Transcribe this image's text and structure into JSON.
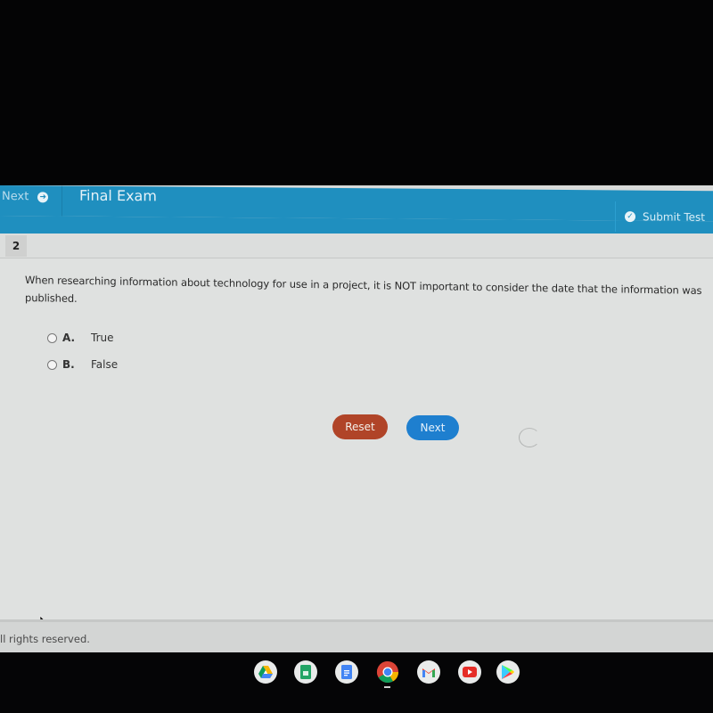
{
  "header": {
    "nav_next_label": "Next",
    "title": "Final Exam",
    "submit_label": "Submit Test"
  },
  "question": {
    "number": "2",
    "text": "When researching information about technology for use in a project, it is NOT important to consider the date that the information was published.",
    "options": [
      {
        "letter": "A.",
        "label": "True",
        "selected": false
      },
      {
        "letter": "B.",
        "label": "False",
        "selected": false
      }
    ]
  },
  "actions": {
    "reset_label": "Reset",
    "next_label": "Next"
  },
  "footer": {
    "text": "ll rights reserved."
  },
  "shelf": {
    "apps": [
      "Google Drive",
      "Google Sheets",
      "Google Docs",
      "Chrome",
      "Gmail",
      "YouTube",
      "Play Store"
    ],
    "active_app": "Chrome"
  },
  "colors": {
    "header_blue": "#1f8fbf",
    "reset_red": "#b04428",
    "next_blue": "#1e7fcf"
  }
}
